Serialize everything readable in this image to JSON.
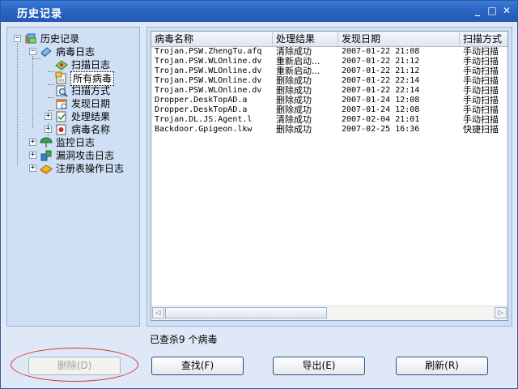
{
  "window": {
    "title": "历史记录",
    "min_glyph": "_",
    "max_glyph": "□",
    "close_glyph": "✕"
  },
  "tree": {
    "root": "历史记录",
    "virus_log": "病毒日志",
    "scan_log": "扫描日志",
    "all_virus": "所有病毒",
    "scan_method": "扫描方式",
    "found_date": "发现日期",
    "result": "处理结果",
    "virus_name": "病毒名称",
    "monitor_log": "监控日志",
    "vuln_log": "漏洞攻击日志",
    "registry_log": "注册表操作日志"
  },
  "table": {
    "columns": [
      "病毒名称",
      "处理结果",
      "发现日期",
      "扫描方式"
    ],
    "rows": [
      [
        "Trojan.PSW.ZhengTu.afq",
        "清除成功",
        "2007-01-22 21:08",
        "手动扫描"
      ],
      [
        "Trojan.PSW.WLOnline.dv",
        "重新启动...",
        "2007-01-22 21:12",
        "手动扫描"
      ],
      [
        "Trojan.PSW.WLOnline.dv",
        "重新启动...",
        "2007-01-22 21:12",
        "手动扫描"
      ],
      [
        "Trojan.PSW.WLOnline.dv",
        "删除成功",
        "2007-01-22 22:14",
        "手动扫描"
      ],
      [
        "Trojan.PSW.WLOnline.dv",
        "删除成功",
        "2007-01-22 22:14",
        "手动扫描"
      ],
      [
        "Dropper.DeskTopAD.a",
        "删除成功",
        "2007-01-24 12:08",
        "手动扫描"
      ],
      [
        "Dropper.DeskTopAD.a",
        "删除成功",
        "2007-01-24 12:08",
        "手动扫描"
      ],
      [
        "Trojan.DL.JS.Agent.l",
        "清除成功",
        "2007-02-04 21:01",
        "手动扫描"
      ],
      [
        "Backdoor.Gpigeon.lkw",
        "删除成功",
        "2007-02-25 16:36",
        "快捷扫描"
      ]
    ]
  },
  "scroll": {
    "left_glyph": "◁",
    "right_glyph": "▷"
  },
  "status": "已查杀9 个病毒",
  "buttons": {
    "delete": "删除(D)",
    "find": "查找(F)",
    "export": "导出(E)",
    "refresh": "刷新(R)"
  },
  "colors": {
    "title_bar": "#2d67c4",
    "panel": "#cfe0f5",
    "annotation_circle": "#d8322c"
  }
}
